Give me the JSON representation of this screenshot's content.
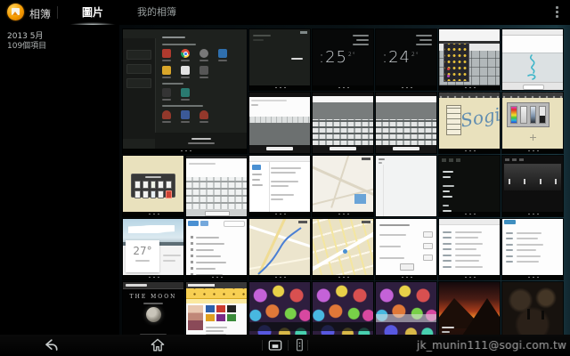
{
  "header": {
    "app_label": "相簿",
    "tabs": [
      {
        "label": "圖片",
        "selected": true
      },
      {
        "label": "我的相簿",
        "selected": false
      }
    ]
  },
  "sidebar": {
    "date_label": "2013 5月",
    "count_label": "109個項目"
  },
  "navbar": {
    "icons": [
      "back-icon",
      "home-icon",
      "recents-icon",
      "quick-app-icon"
    ],
    "watermark": "jk_munin111@sogi.com.tw"
  },
  "colors": {
    "accent_orange": "#f59b00",
    "background": "#000000",
    "grid_glow_teal": "#1b3942",
    "note_cream": "#e9e1bd",
    "map_tan": "#ece5cd"
  },
  "grid": {
    "columns": 7,
    "rows": 5,
    "tiles": [
      {
        "name": "backup-restore-screen",
        "kind": "restore",
        "row": 1,
        "col": 1,
        "span": 2
      },
      {
        "name": "dark-app-screen",
        "kind": "darkapp",
        "row": 1,
        "col": 3
      },
      {
        "name": "lockscreen-clock-25",
        "kind": "clock",
        "row": 1,
        "col": 4,
        "text": ":25",
        "sup": "2°"
      },
      {
        "name": "lockscreen-clock-24",
        "kind": "clock",
        "row": 1,
        "col": 5,
        "text": ":24",
        "sup": "2°"
      },
      {
        "name": "emoji-keyboard-screen",
        "kind": "emoji",
        "row": 1,
        "col": 6
      },
      {
        "name": "handwriting-note-screen",
        "kind": "cyannote",
        "row": 1,
        "col": 7
      },
      {
        "name": "note-with-keyboard-screen",
        "kind": "notekbd",
        "row": 2,
        "col": 3
      },
      {
        "name": "keyboard-screen-1",
        "kind": "fullkbd",
        "row": 2,
        "col": 4
      },
      {
        "name": "keyboard-screen-2",
        "kind": "fullkbd",
        "row": 2,
        "col": 5
      },
      {
        "name": "sogi-sketch-screen",
        "kind": "sogi",
        "row": 2,
        "col": 6,
        "text": "Sogi"
      },
      {
        "name": "color-palette-screen",
        "kind": "palette",
        "row": 2,
        "col": 7
      },
      {
        "name": "paper-picker-screen",
        "kind": "swatches",
        "row": 3,
        "col": 1
      },
      {
        "name": "keyboard-screen-3",
        "kind": "bigkbd",
        "row": 3,
        "col": 2
      },
      {
        "name": "settings-split-screen",
        "kind": "settings",
        "row": 3,
        "col": 3
      },
      {
        "name": "map-screen-1",
        "kind": "maplight",
        "row": 3,
        "col": 4
      },
      {
        "name": "blank-document-screen",
        "kind": "blankdoc",
        "row": 3,
        "col": 5
      },
      {
        "name": "dark-list-screen",
        "kind": "darklist",
        "row": 3,
        "col": 6
      },
      {
        "name": "media-player-screen",
        "kind": "mediadark",
        "row": 3,
        "col": 7
      },
      {
        "name": "weather-screen",
        "kind": "weather",
        "row": 4,
        "col": 1,
        "text": "27°"
      },
      {
        "name": "menu-list-screen",
        "kind": "menulist",
        "row": 4,
        "col": 2
      },
      {
        "name": "map-route-screen",
        "kind": "maproute",
        "row": 4,
        "col": 3
      },
      {
        "name": "map-screen-2",
        "kind": "maproute2",
        "row": 4,
        "col": 4
      },
      {
        "name": "form-document-screen",
        "kind": "formdoc",
        "row": 4,
        "col": 5
      },
      {
        "name": "table-list-screen-1",
        "kind": "tablelist",
        "row": 4,
        "col": 6
      },
      {
        "name": "table-list-screen-2",
        "kind": "tablelist2",
        "row": 4,
        "col": 7
      },
      {
        "name": "moon-webpage",
        "kind": "moon",
        "row": 5,
        "col": 1,
        "text": "THE MOON"
      },
      {
        "name": "sogi-webpage",
        "kind": "webpage",
        "row": 5,
        "col": 2
      },
      {
        "name": "gems-wallpaper-1",
        "kind": "gems",
        "row": 5,
        "col": 3
      },
      {
        "name": "gems-wallpaper-2",
        "kind": "gems",
        "row": 5,
        "col": 4
      },
      {
        "name": "gems-wallpaper-3",
        "kind": "gems2",
        "row": 5,
        "col": 5
      },
      {
        "name": "sunset-photo",
        "kind": "sunset",
        "row": 5,
        "col": 6
      },
      {
        "name": "dark-movie-scene",
        "kind": "movie",
        "row": 5,
        "col": 7
      }
    ]
  }
}
